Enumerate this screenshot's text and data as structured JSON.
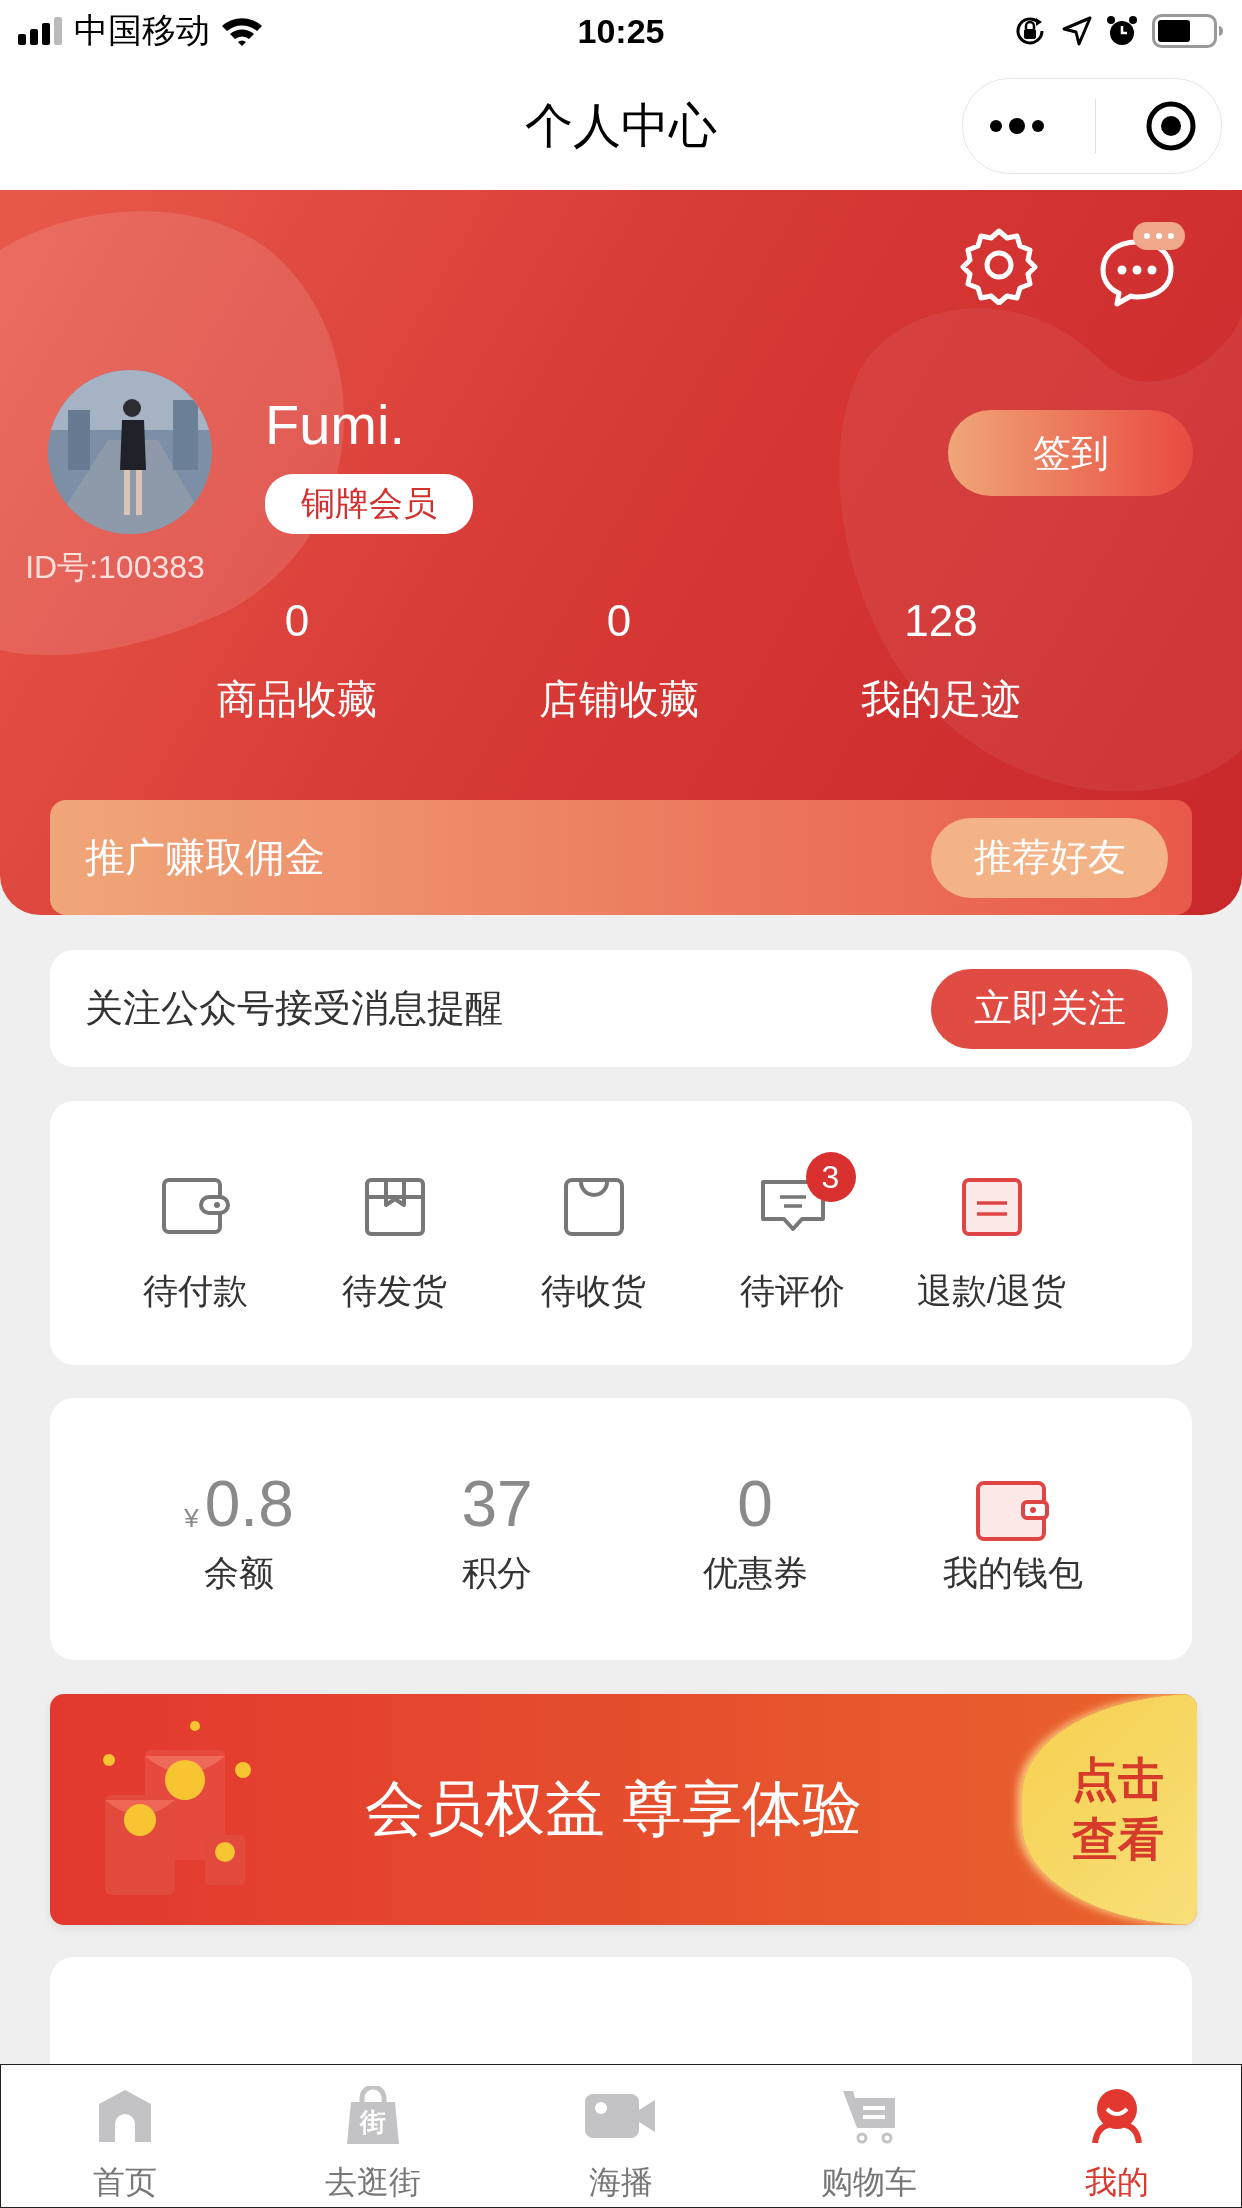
{
  "status_bar": {
    "carrier": "中国移动",
    "time": "10:25"
  },
  "nav": {
    "title": "个人中心"
  },
  "profile": {
    "name": "Fumi.",
    "level_badge": "铜牌会员",
    "id_text": "ID号:100383",
    "sign_in_button": "签到",
    "stats": [
      {
        "value": "0",
        "label": "商品收藏"
      },
      {
        "value": "0",
        "label": "店铺收藏"
      },
      {
        "value": "128",
        "label": "我的足迹"
      }
    ]
  },
  "promo_bar": {
    "text": "推广赚取佣金",
    "button": "推荐好友"
  },
  "follow_bar": {
    "text": "关注公众号接受消息提醒",
    "button": "立即关注"
  },
  "orders": [
    {
      "kind": "pay",
      "label": "待付款"
    },
    {
      "kind": "ship",
      "label": "待发货"
    },
    {
      "kind": "receive",
      "label": "待收货"
    },
    {
      "kind": "review",
      "label": "待评价",
      "badge": "3"
    },
    {
      "kind": "refund",
      "label": "退款/退货"
    }
  ],
  "wallet": [
    {
      "kind": "amount",
      "prefix": "¥",
      "value": "0.8",
      "label": "余额"
    },
    {
      "kind": "number",
      "value": "37",
      "label": "积分"
    },
    {
      "kind": "number",
      "value": "0",
      "label": "优惠券"
    },
    {
      "kind": "icon",
      "label": "我的钱包"
    }
  ],
  "banner": {
    "title": "会员权益 尊享体验",
    "action": "点击查看"
  },
  "tab_bar": [
    {
      "kind": "home",
      "label": "首页",
      "selected": false
    },
    {
      "kind": "street",
      "label": "去逛街",
      "icon_text": "街",
      "selected": false
    },
    {
      "kind": "video",
      "label": "海播",
      "selected": false
    },
    {
      "kind": "cart",
      "label": "购物车",
      "selected": false
    },
    {
      "kind": "me",
      "label": "我的",
      "selected": true
    }
  ]
}
